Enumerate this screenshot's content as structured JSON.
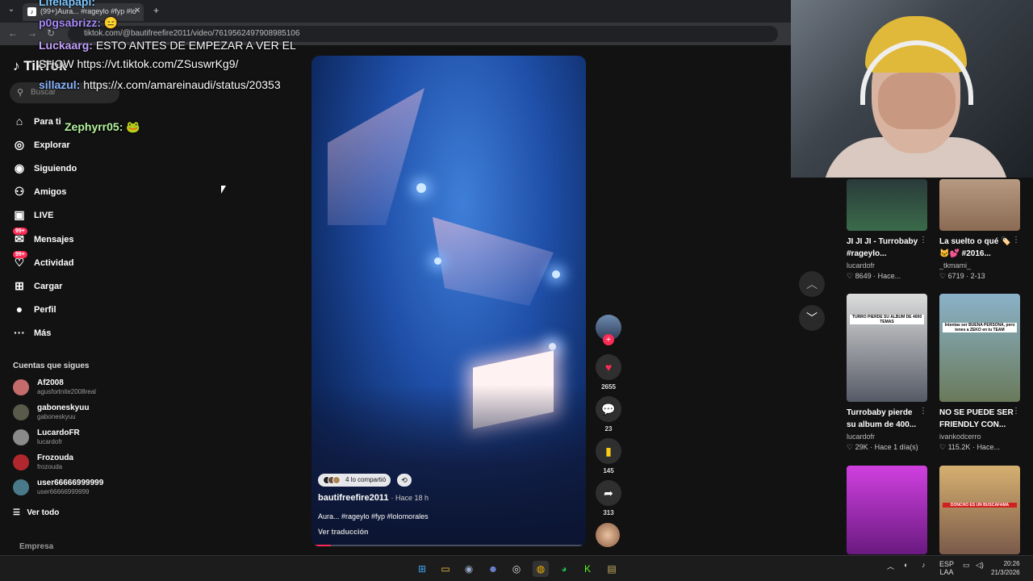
{
  "browser": {
    "tab_title": "(99+)Aura... #rageylo #fyp #lo",
    "url": "tiktok.com/@bautifreefire2011/video/7619562497908985106"
  },
  "sidebar": {
    "logo": "TikTok",
    "search_placeholder": "Buscar",
    "items": [
      {
        "label": "Para ti",
        "icon": "home-icon"
      },
      {
        "label": "Explorar",
        "icon": "compass-icon"
      },
      {
        "label": "Siguiendo",
        "icon": "following-icon"
      },
      {
        "label": "Amigos",
        "icon": "friends-icon"
      },
      {
        "label": "LIVE",
        "icon": "live-icon"
      },
      {
        "label": "Mensajes",
        "icon": "messages-icon",
        "badge": "99+"
      },
      {
        "label": "Actividad",
        "icon": "activity-icon",
        "badge": "99+"
      },
      {
        "label": "Cargar",
        "icon": "upload-icon"
      },
      {
        "label": "Perfil",
        "icon": "profile-icon"
      },
      {
        "label": "Más",
        "icon": "more-icon"
      }
    ],
    "following_title": "Cuentas que sigues",
    "following": [
      {
        "name": "Af2008",
        "user": "agusfortnite2008real"
      },
      {
        "name": "gaboneskyuu",
        "user": "gaboneskyuu"
      },
      {
        "name": "LucardoFR",
        "user": "lucardofr"
      },
      {
        "name": "Frozouda",
        "user": "frozouda"
      },
      {
        "name": "user66666999999",
        "user": "user66666999999"
      }
    ],
    "see_all": "Ver todo",
    "empresa": "Empresa"
  },
  "chat": [
    {
      "user": "Lifelapapi:",
      "msg": "",
      "color": "#7ec8ff"
    },
    {
      "user": "p0gsabrizz:",
      "msg": "",
      "color": "#a78bfa"
    },
    {
      "user": "Luckaarg:",
      "msg": "ESTO ANTES DE EMPEZAR A VER EL",
      "color": "#c4a3ff"
    },
    {
      "user": "",
      "msg": "SHOW https://vt.tiktok.com/ZSuswrKg9/",
      "color": "#fff"
    },
    {
      "user": "sillazul:",
      "msg": "https://x.com/amareinaudi/status/20353",
      "color": "#8ab4ff"
    },
    {
      "user": "Zephyrr05:",
      "msg": "",
      "color": "#b5f5a0"
    }
  ],
  "video": {
    "shared_text": "4 lo compartió",
    "author": "bautifreefire2011",
    "time": "· Hace 18 h",
    "caption": "Aura... #rageylo #fyp #lolomorales",
    "translate": "Ver traducción",
    "progress": 0.07,
    "likes": "2655",
    "comments": "23",
    "saves": "145",
    "shares": "313"
  },
  "recommendations": [
    {
      "title": "JI JI JI - Turrobaby #rageylo...",
      "author": "lucardofr",
      "likes": "8649",
      "time": "Hace...",
      "color": "#3a6b4a"
    },
    {
      "title": "La suelto o qué 🏷️ 🐱💕 #2016...",
      "author": "_tkmami_",
      "likes": "6719",
      "time": "2-13",
      "color": "#8a6a52"
    },
    {
      "title": "Turrobaby pierde su album de 400...",
      "author": "lucardofr",
      "likes": "29K",
      "time": "Hace 1 día(s)",
      "color": "#555a66",
      "overlay": "TURRO PIERDE SU ALBUM DE 4000 TEMAS"
    },
    {
      "title": "NO SE PUEDE SER FRIENDLY CON...",
      "author": "ivankodcerro",
      "likes": "115.2K",
      "time": "Hace...",
      "color": "#6a7a5a",
      "overlay": "Intentas ser BUENA PERSONA, pero tenes a ZEKO en tu TEAM"
    },
    {
      "title": "",
      "author": "",
      "likes": "",
      "time": "",
      "color": "#b03ad0"
    },
    {
      "title": "",
      "author": "",
      "likes": "",
      "time": "",
      "color": "#7a5a4a",
      "overlay": "DONCHO ES UN BUSCAFAMA"
    }
  ],
  "taskbar": {
    "lang": "ESP",
    "lang2": "LAA",
    "time": "20:26",
    "date": "21/3/2026"
  }
}
